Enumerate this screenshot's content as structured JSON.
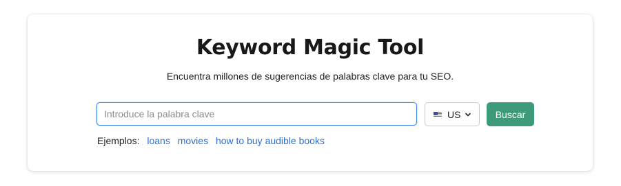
{
  "header": {
    "title": "Keyword Magic Tool",
    "subtitle": "Encuentra millones de sugerencias de palabras clave para tu SEO."
  },
  "search": {
    "placeholder": "Introduce la palabra clave",
    "value": "",
    "country": {
      "flag_icon": "us-flag-icon",
      "code": "US",
      "chevron_icon": "chevron-down-icon"
    },
    "button_label": "Buscar",
    "button_color": "#3d9b7a",
    "focus_color": "#3b8be8"
  },
  "examples": {
    "label": "Ejemplos:",
    "links": [
      "loans",
      "movies",
      "how to buy audible books"
    ],
    "link_color": "#2e6fd0"
  }
}
